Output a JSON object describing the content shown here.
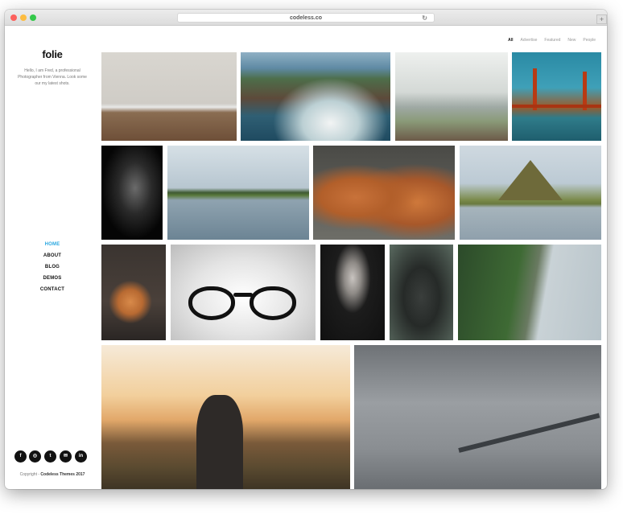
{
  "browser": {
    "url": "codeless.co",
    "reload_icon": "reload-icon",
    "newtab_symbol": "+"
  },
  "sidebar": {
    "logo": "folie",
    "intro": "Hello, I am Fred, a professional Photographer from Vienna. Look some our my latest shots.",
    "nav": [
      {
        "label": "HOME",
        "active": true
      },
      {
        "label": "ABOUT"
      },
      {
        "label": "BLOG"
      },
      {
        "label": "DEMOS"
      },
      {
        "label": "CONTACT"
      }
    ],
    "socials": [
      {
        "icon": "facebook-icon",
        "glyph": "f"
      },
      {
        "icon": "instagram-icon",
        "glyph": "◎"
      },
      {
        "icon": "twitter-icon",
        "glyph": "t"
      },
      {
        "icon": "email-icon",
        "glyph": "✉"
      },
      {
        "icon": "linkedin-icon",
        "glyph": "in"
      }
    ],
    "copyright_prefix": "Copyright -",
    "copyright_brand": "Codeless Themes 2017"
  },
  "filters": [
    "All",
    "Advertise",
    "Featured",
    "New",
    "People"
  ],
  "colors": {
    "accent": "#2aa8e0",
    "text": "#111111",
    "muted": "#777777"
  },
  "gallery": [
    {
      "name": "photo-desert-plain"
    },
    {
      "name": "photo-rocky-coast"
    },
    {
      "name": "photo-foggy-lake"
    },
    {
      "name": "photo-golden-gate-bridge"
    },
    {
      "name": "photo-dark-portrait"
    },
    {
      "name": "photo-lake-island"
    },
    {
      "name": "photo-fighting-foxes"
    },
    {
      "name": "photo-mountain-reflection"
    },
    {
      "name": "photo-cocktail-glass"
    },
    {
      "name": "photo-eyeglasses"
    },
    {
      "name": "photo-woman-portrait"
    },
    {
      "name": "photo-black-wolf"
    },
    {
      "name": "photo-forest-coastline"
    },
    {
      "name": "photo-man-drinking"
    },
    {
      "name": "photo-long-bridge"
    }
  ]
}
